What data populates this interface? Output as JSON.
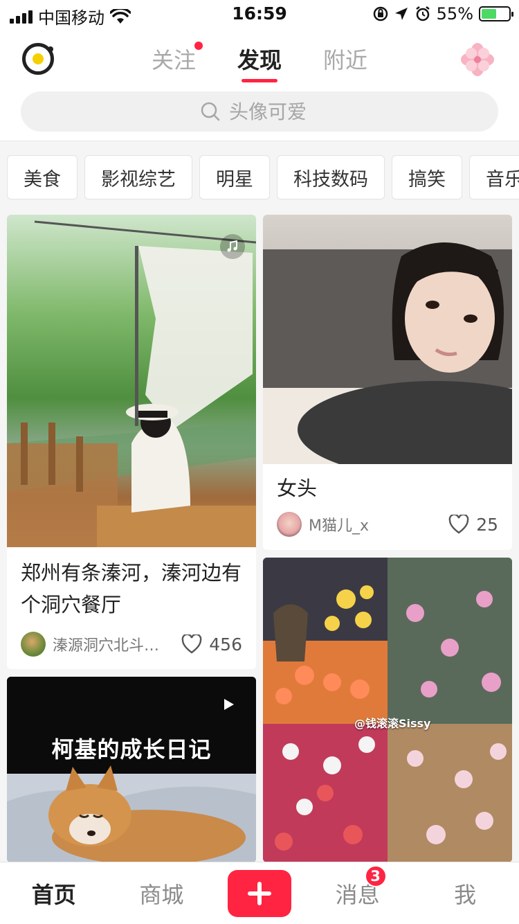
{
  "status_bar": {
    "carrier": "中国移动",
    "time": "16:59",
    "battery_percent": "55%",
    "battery_level": 0.55
  },
  "header": {
    "tabs": [
      {
        "label": "关注",
        "has_dot": true
      },
      {
        "label": "发现",
        "active": true
      },
      {
        "label": "附近"
      }
    ]
  },
  "search": {
    "placeholder": "头像可爱"
  },
  "categories": [
    "美食",
    "影视综艺",
    "明星",
    "科技数码",
    "搞笑",
    "音乐"
  ],
  "feed": [
    {
      "title": "郑州有条溱河，溱河边有个洞穴餐厅",
      "author": "溱源洞穴北斗…",
      "likes": "456",
      "media_icon": "music-icon"
    },
    {
      "title": "女头",
      "author": "M猫儿_x",
      "likes": "25"
    },
    {
      "image_text": "@钱滚滚Sissy"
    },
    {
      "image_text": "柯基的成长日记",
      "media_icon": "play-icon"
    }
  ],
  "bottom_nav": {
    "items": [
      "首页",
      "商城",
      "消息",
      "我"
    ],
    "messages_badge": "3"
  },
  "colors": {
    "accent": "#ff2442",
    "logo_yellow": "#f5d000"
  }
}
